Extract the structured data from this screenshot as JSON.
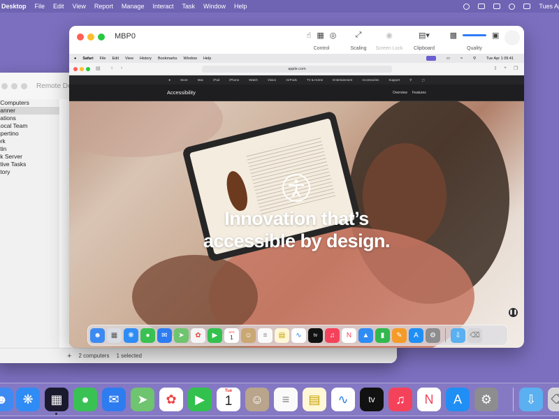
{
  "host_menubar": {
    "app_name": "Desktop",
    "menus": [
      "File",
      "Edit",
      "View",
      "Report",
      "Manage",
      "Interact",
      "Task",
      "Window",
      "Help"
    ],
    "status_icons": [
      "user-icon",
      "display-icon",
      "battery-icon",
      "screen-sharing-icon",
      "control-center-icon"
    ],
    "clock": "Tues Ap"
  },
  "remote_desktop": {
    "title": "Remote Deskto",
    "sidebar": [
      {
        "label": "l Computers",
        "selected": false
      },
      {
        "label": "canner",
        "selected": true
      },
      {
        "label": "cations",
        "selected": false
      },
      {
        "label": "Local Team",
        "selected": false
      },
      {
        "label": "upertino",
        "selected": false
      },
      {
        "label": "ork",
        "selected": false
      },
      {
        "label": "stin",
        "selected": false
      },
      {
        "label": "sk Server",
        "selected": false
      },
      {
        "label": "ctive Tasks",
        "selected": false
      },
      {
        "label": "story",
        "selected": false
      }
    ],
    "footer": {
      "add": "+",
      "computers": "2 computers",
      "selected": "1 selected"
    }
  },
  "screen_sharing": {
    "title": "MBP0",
    "toolbar": {
      "control_label": "Control",
      "scaling_label": "Scaling",
      "screen_lock_label": "Screen Lock",
      "clipboard_label": "Clipboard",
      "quality_label": "Quality"
    }
  },
  "remote": {
    "menubar": {
      "app": "Safari",
      "menus": [
        "File",
        "Edit",
        "View",
        "History",
        "Bookmarks",
        "Window",
        "Help"
      ],
      "clock": "Tue Apr 1 09:41"
    },
    "url": "apple.com",
    "apple_nav": [
      "Store",
      "Mac",
      "iPad",
      "iPhone",
      "Watch",
      "Vision",
      "AirPods",
      "TV & Home",
      "Entertainment",
      "Accessories",
      "Support"
    ],
    "section_title": "Accessibility",
    "section_links": [
      "Overview",
      "Features"
    ],
    "hero_line1": "Innovation that’s",
    "hero_line2": "accessible by design.",
    "calendar_month": "APR",
    "calendar_day": "1",
    "appletv_label": "tv"
  },
  "host_dock": {
    "calendar_weekday": "Tue",
    "calendar_day": "1",
    "appletv_label": "tv"
  },
  "colors": {
    "wallpaper": "#7c6fbf",
    "accent_blue": "#2f7bf6",
    "close": "#ff5f57",
    "minimize": "#febc2e",
    "zoom": "#28c840"
  }
}
